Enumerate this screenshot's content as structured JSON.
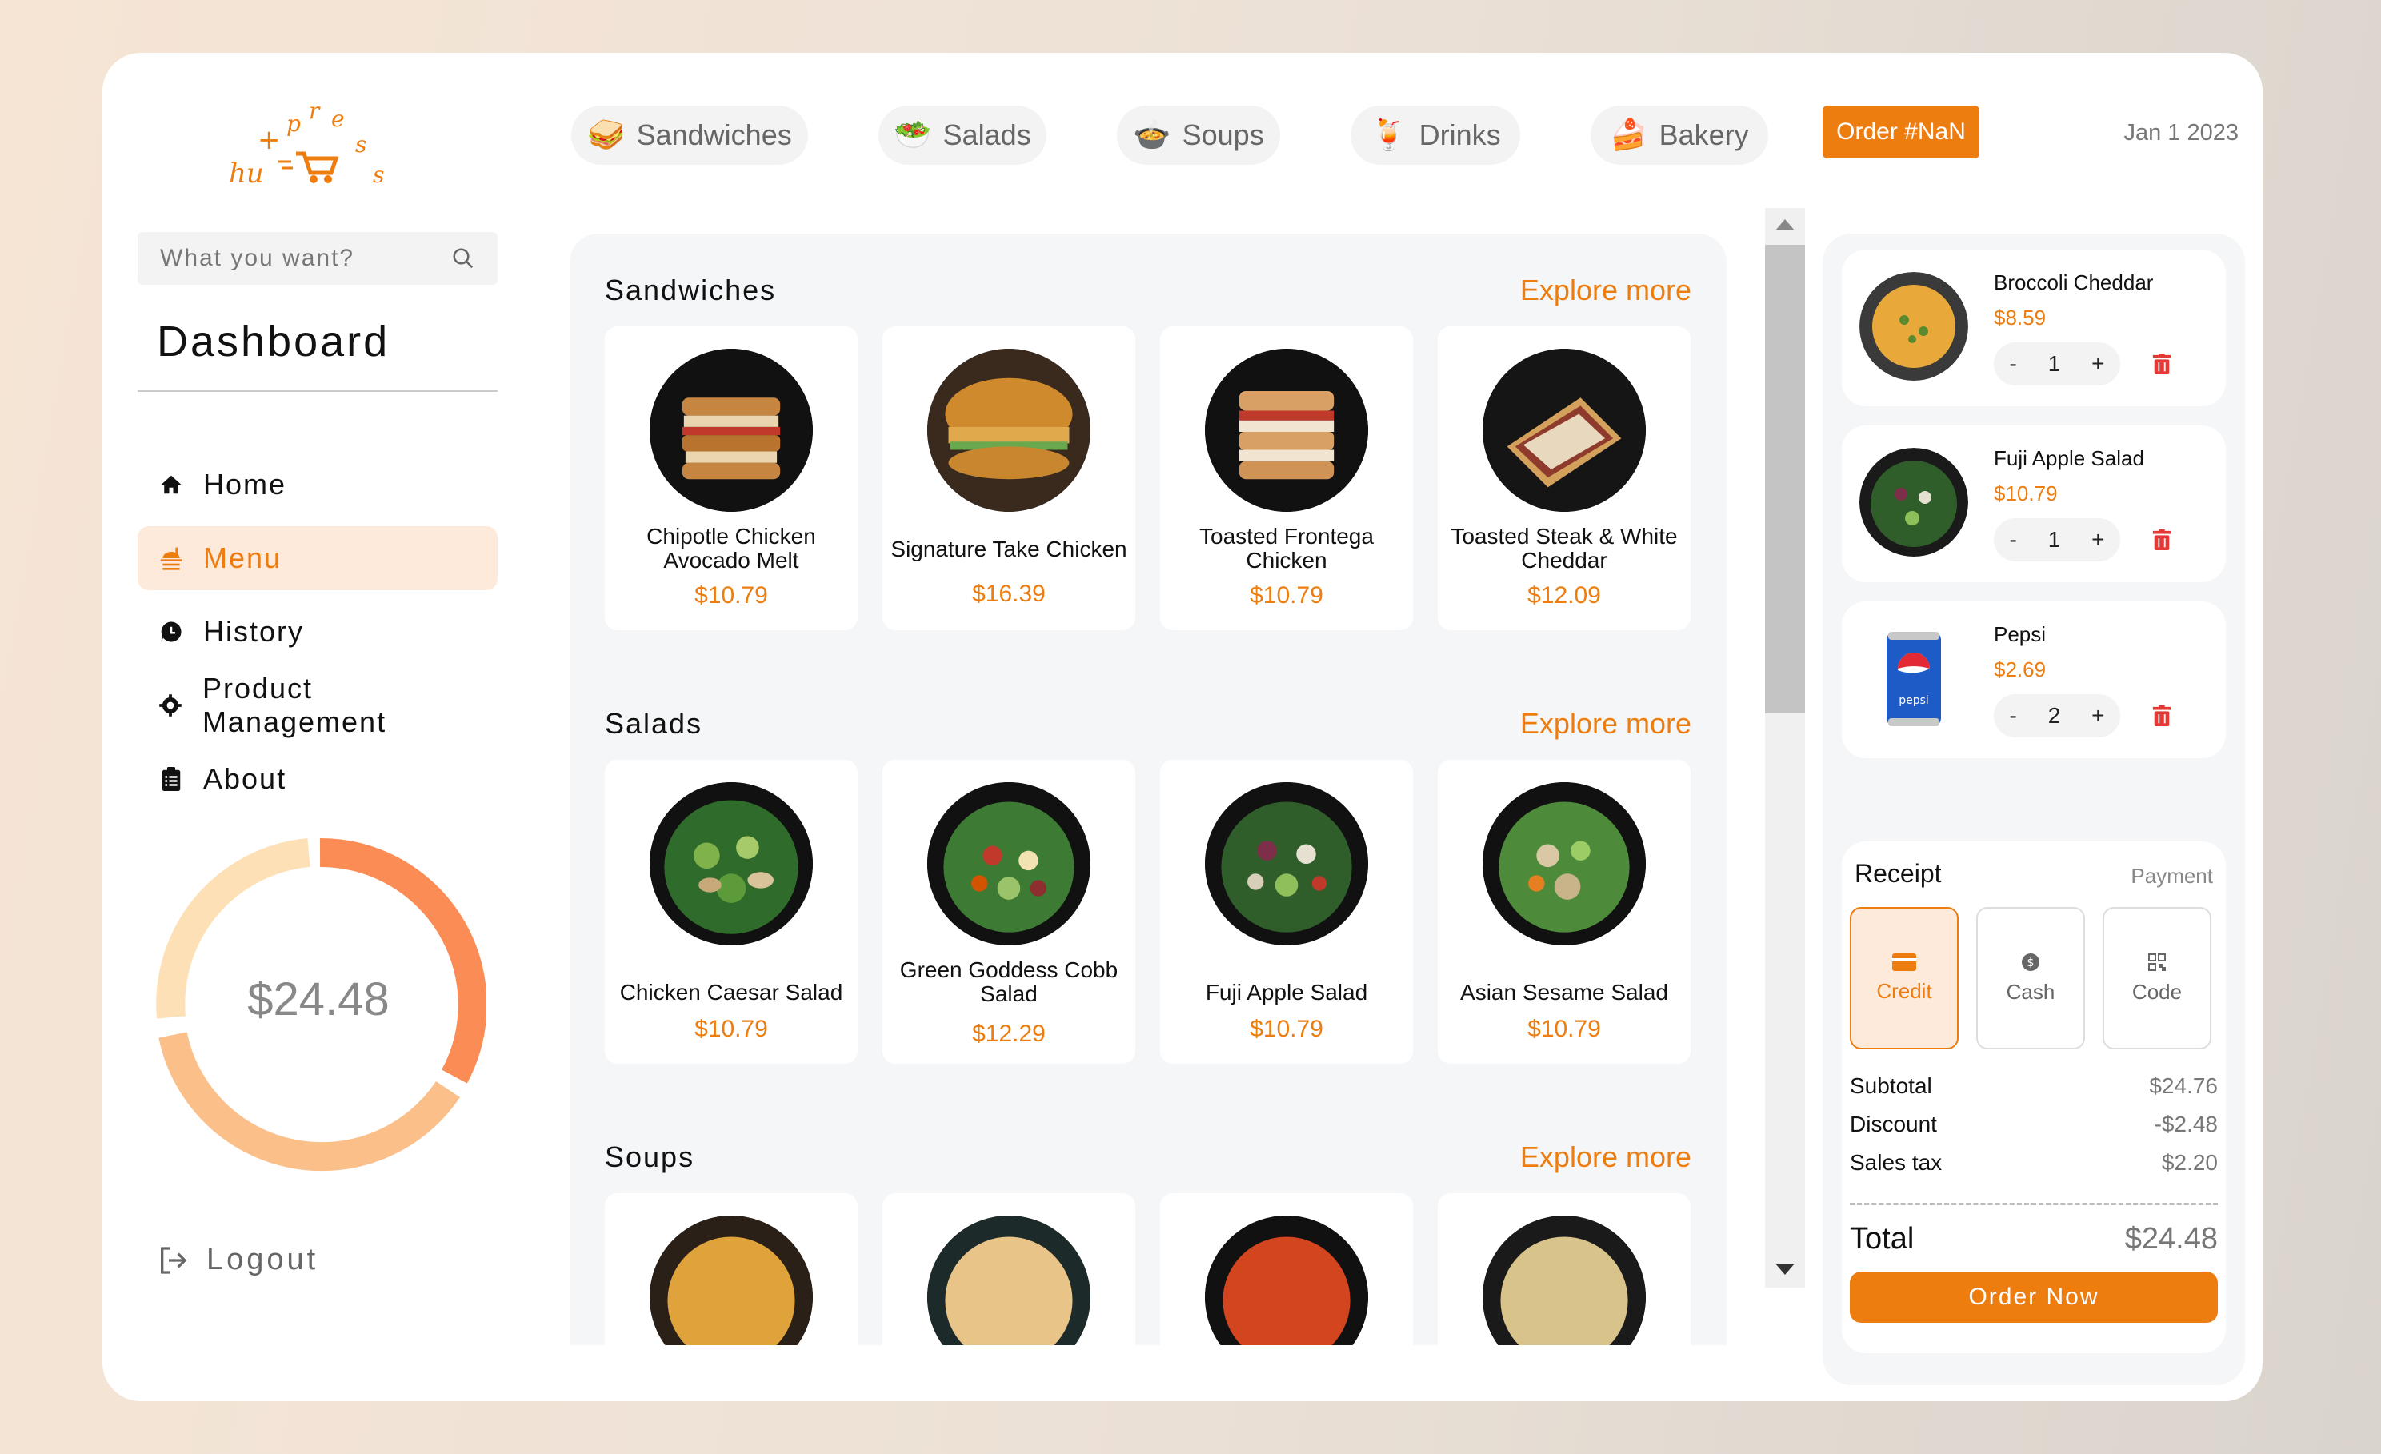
{
  "brand": {
    "logo_text": "hu+pres"
  },
  "categories": [
    {
      "label": "Sandwiches",
      "icon": "sandwich-icon"
    },
    {
      "label": "Salads",
      "icon": "salad-icon"
    },
    {
      "label": "Soups",
      "icon": "soup-icon"
    },
    {
      "label": "Drinks",
      "icon": "drink-icon"
    },
    {
      "label": "Bakery",
      "icon": "cake-icon"
    }
  ],
  "header": {
    "order_label": "Order #NaN",
    "date": "Jan 1 2023"
  },
  "sidebar": {
    "search_placeholder": "What you want?",
    "title": "Dashboard",
    "nav": [
      {
        "label": "Home",
        "icon": "home-icon",
        "active": false
      },
      {
        "label": "Menu",
        "icon": "menu-icon",
        "active": true
      },
      {
        "label": "History",
        "icon": "history-icon",
        "active": false
      },
      {
        "label": "Product Management",
        "icon": "gear-icon",
        "active": false
      },
      {
        "label": "About",
        "icon": "clipboard-icon",
        "active": false
      }
    ],
    "donut_total": "$24.48",
    "logout_label": "Logout"
  },
  "menu": {
    "explore_label": "Explore more",
    "sections": [
      {
        "title": "Sandwiches",
        "items": [
          {
            "name": "Chipotle Chicken Avocado Melt",
            "price": "$10.79"
          },
          {
            "name": "Signature Take Chicken",
            "price": "$16.39"
          },
          {
            "name": "Toasted Frontega Chicken",
            "price": "$10.79"
          },
          {
            "name": "Toasted Steak & White Cheddar",
            "price": "$12.09"
          }
        ]
      },
      {
        "title": "Salads",
        "items": [
          {
            "name": "Chicken Caesar Salad",
            "price": "$10.79"
          },
          {
            "name": "Green Goddess Cobb Salad",
            "price": "$12.29"
          },
          {
            "name": "Fuji Apple Salad",
            "price": "$10.79"
          },
          {
            "name": "Asian Sesame Salad",
            "price": "$10.79"
          }
        ]
      },
      {
        "title": "Soups",
        "items": []
      }
    ]
  },
  "cart": {
    "items": [
      {
        "name": "Broccoli Cheddar",
        "price": "$8.59",
        "qty": "1"
      },
      {
        "name": "Fuji Apple Salad",
        "price": "$10.79",
        "qty": "1"
      },
      {
        "name": "Pepsi",
        "price": "$2.69",
        "qty": "2",
        "thumb_label": "pepsi"
      }
    ],
    "receipt": {
      "title": "Receipt",
      "payment_label": "Payment",
      "methods": [
        {
          "label": "Credit",
          "icon": "credit-card-icon",
          "active": true
        },
        {
          "label": "Cash",
          "icon": "cash-icon",
          "active": false
        },
        {
          "label": "Code",
          "icon": "qr-code-icon",
          "active": false
        }
      ],
      "subtotal_label": "Subtotal",
      "subtotal": "$24.76",
      "discount_label": "Discount",
      "discount": "-$2.48",
      "tax_label": "Sales tax",
      "tax": "$2.20",
      "total_label": "Total",
      "total": "$24.48",
      "order_button": "Order Now"
    }
  },
  "colors": {
    "accent": "#ee7d10",
    "accent_light": "#fdeadb",
    "donut_dark": "#fb8c55",
    "donut_mid": "#fbc08a",
    "donut_light": "#fde0b5"
  }
}
